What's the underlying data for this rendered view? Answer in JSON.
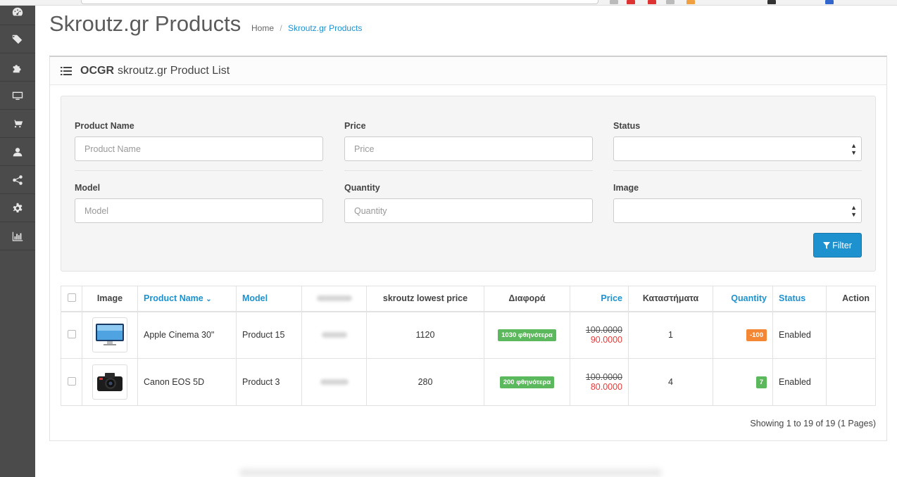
{
  "sidebar": {
    "items": [
      {
        "icon": "dashboard-icon"
      },
      {
        "icon": "tags-icon"
      },
      {
        "icon": "puzzle-icon"
      },
      {
        "icon": "desktop-icon"
      },
      {
        "icon": "cart-icon"
      },
      {
        "icon": "user-icon"
      },
      {
        "icon": "share-icon"
      },
      {
        "icon": "cog-icon"
      },
      {
        "icon": "bar-chart-icon"
      }
    ]
  },
  "header": {
    "title": "Skroutz.gr Products",
    "breadcrumb": {
      "home": "Home",
      "separator": "/",
      "current": "Skroutz.gr Products"
    }
  },
  "panel": {
    "title_bold": "OCGR",
    "title_rest": "skroutz.gr Product List"
  },
  "filters": {
    "product_name": {
      "label": "Product Name",
      "placeholder": "Product Name"
    },
    "price": {
      "label": "Price",
      "placeholder": "Price"
    },
    "status": {
      "label": "Status",
      "value": ""
    },
    "model": {
      "label": "Model",
      "placeholder": "Model"
    },
    "quantity": {
      "label": "Quantity",
      "placeholder": "Quantity"
    },
    "image": {
      "label": "Image",
      "value": ""
    },
    "filter_button": "Filter"
  },
  "table": {
    "headers": {
      "image": "Image",
      "product_name": "Product Name",
      "model": "Model",
      "skroutz_lowest": "skroutz lowest price",
      "diff": "Διαφορά",
      "price": "Price",
      "stores": "Καταστήματα",
      "quantity": "Quantity",
      "status": "Status",
      "action": "Action"
    },
    "rows": [
      {
        "name": "Apple Cinema 30\"",
        "model": "Product 15",
        "skroutz_lowest": "1120",
        "diff": "1030 φθηνότερα",
        "price_old": "100.0000",
        "price_new": "90.0000",
        "stores": "1",
        "quantity": "-100",
        "status": "Enabled",
        "thumb_icon": "monitor-icon"
      },
      {
        "name": "Canon EOS 5D",
        "model": "Product 3",
        "skroutz_lowest": "280",
        "diff": "200 φθηνότερα",
        "price_old": "100.0000",
        "price_new": "80.0000",
        "stores": "4",
        "quantity": "7",
        "status": "Enabled",
        "thumb_icon": "camera-icon"
      }
    ]
  },
  "pagination": {
    "info": "Showing 1 to 19 of 19 (1 Pages)"
  },
  "colors": {
    "accent": "#1e91cf",
    "sidebar": "#4b4b4b",
    "badge_green": "#5cb85c",
    "badge_orange": "#f38733",
    "price_red": "#e23c3c"
  }
}
